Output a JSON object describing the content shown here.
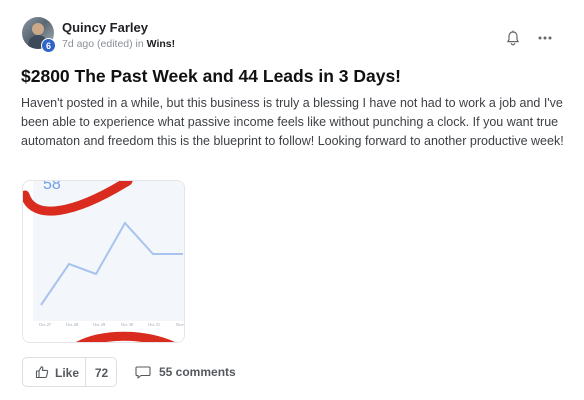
{
  "post": {
    "author": "Quincy Farley",
    "level": "6",
    "meta_prefix": "7d ago (edited) in ",
    "category": "Wins!",
    "title": "$2800 The Past Week and 44 Leads in 3 Days!",
    "body": "Haven't posted in a while, but this business is truly a blessing I have not had to work a job and I've been able to experience what passive income feels like without punching a clock. If you want true automaton and freedom this is the blueprint to follow! Looking forward to another productive week!"
  },
  "header_icons": {
    "notify": "bell-icon",
    "menu": "more-icon"
  },
  "attachment": {
    "top_number": "58",
    "x_ticks": [
      "Oct 27",
      "Oct 28",
      "Oct 29",
      "Oct 30",
      "Oct 31",
      "Nov"
    ],
    "line_color": "#a8c4ee",
    "annotation_color": "#d92b1e"
  },
  "actions": {
    "like_label": "Like",
    "like_count": "72",
    "comments_label": "55 comments"
  }
}
